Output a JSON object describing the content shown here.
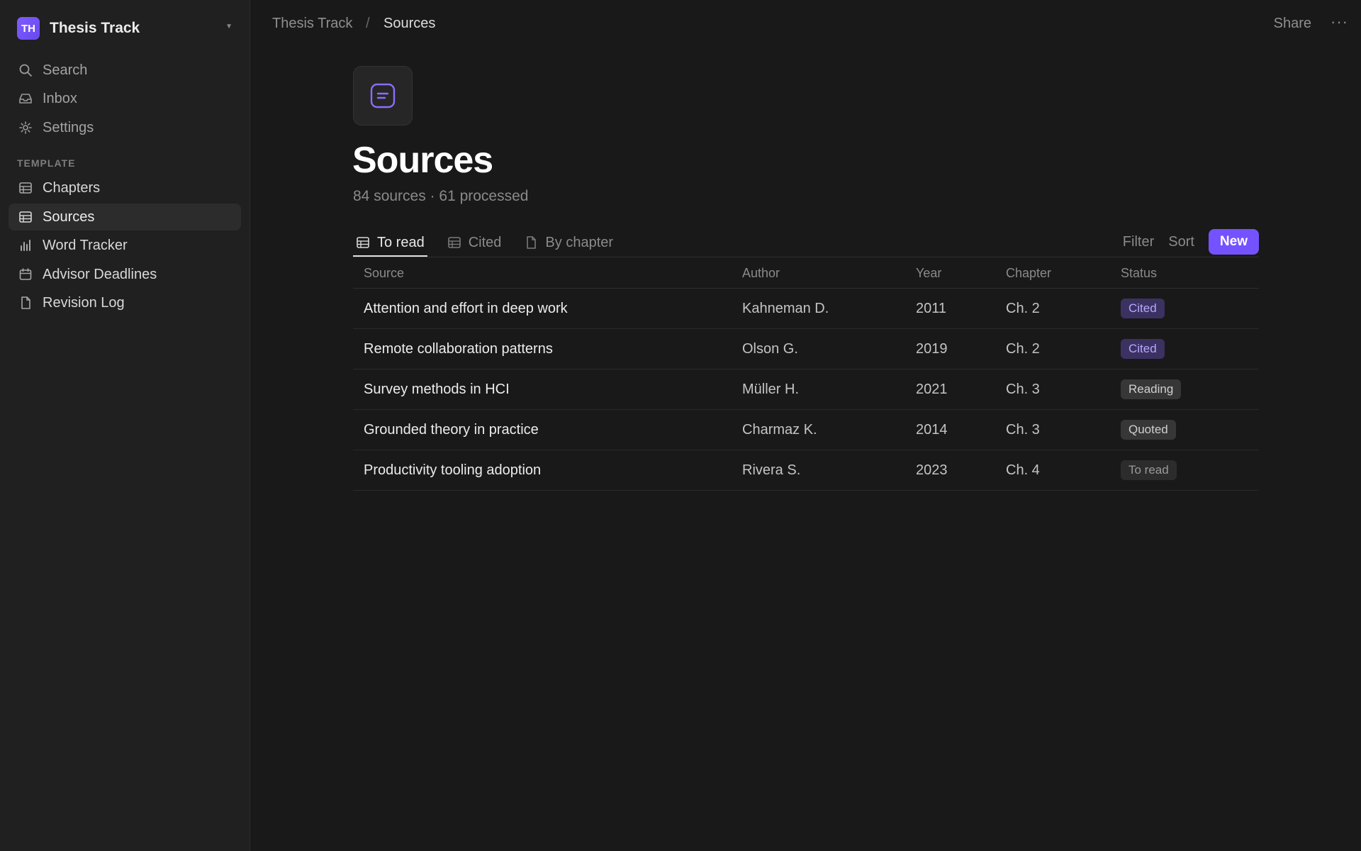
{
  "workspace": {
    "initials": "TH",
    "name": "Thesis Track"
  },
  "sidebar": {
    "top_items": [
      {
        "label": "Search",
        "icon": "search-icon"
      },
      {
        "label": "Inbox",
        "icon": "inbox-icon"
      },
      {
        "label": "Settings",
        "icon": "gear-icon"
      }
    ],
    "section_label": "TEMPLATE",
    "items": [
      {
        "label": "Chapters",
        "icon": "table-icon"
      },
      {
        "label": "Sources",
        "icon": "table-icon",
        "active": true
      },
      {
        "label": "Word Tracker",
        "icon": "bar-chart-icon"
      },
      {
        "label": "Advisor Deadlines",
        "icon": "calendar-icon"
      },
      {
        "label": "Revision Log",
        "icon": "document-icon"
      }
    ]
  },
  "topbar": {
    "breadcrumb": [
      "Thesis Track",
      "Sources"
    ],
    "separator": "/",
    "share_label": "Share",
    "more_label": "···"
  },
  "page": {
    "icon": "note-icon",
    "title": "Sources",
    "subtitle": "84 sources · 61 processed"
  },
  "tabs": [
    {
      "label": "To read",
      "icon": "table-icon",
      "active": true
    },
    {
      "label": "Cited",
      "icon": "table-icon"
    },
    {
      "label": "By chapter",
      "icon": "document-icon"
    }
  ],
  "actions": {
    "filter": "Filter",
    "sort": "Sort",
    "new": "New"
  },
  "table": {
    "columns": [
      "Source",
      "Author",
      "Year",
      "Chapter",
      "Status"
    ],
    "rows": [
      {
        "source": "Attention and effort in deep work",
        "author": "Kahneman D.",
        "year": "2011",
        "chapter": "Ch. 2",
        "status": "Cited"
      },
      {
        "source": "Remote collaboration patterns",
        "author": "Olson G.",
        "year": "2019",
        "chapter": "Ch. 2",
        "status": "Cited"
      },
      {
        "source": "Survey methods in HCI",
        "author": "Müller H.",
        "year": "2021",
        "chapter": "Ch. 3",
        "status": "Reading"
      },
      {
        "source": "Grounded theory in practice",
        "author": "Charmaz K.",
        "year": "2014",
        "chapter": "Ch. 3",
        "status": "Quoted"
      },
      {
        "source": "Productivity tooling adoption",
        "author": "Rivera S.",
        "year": "2023",
        "chapter": "Ch. 4",
        "status": "To read"
      }
    ]
  },
  "colors": {
    "accent": "#7452ff",
    "background": "#191919",
    "sidebar": "#202020",
    "cited_badge": "#3b3262"
  }
}
